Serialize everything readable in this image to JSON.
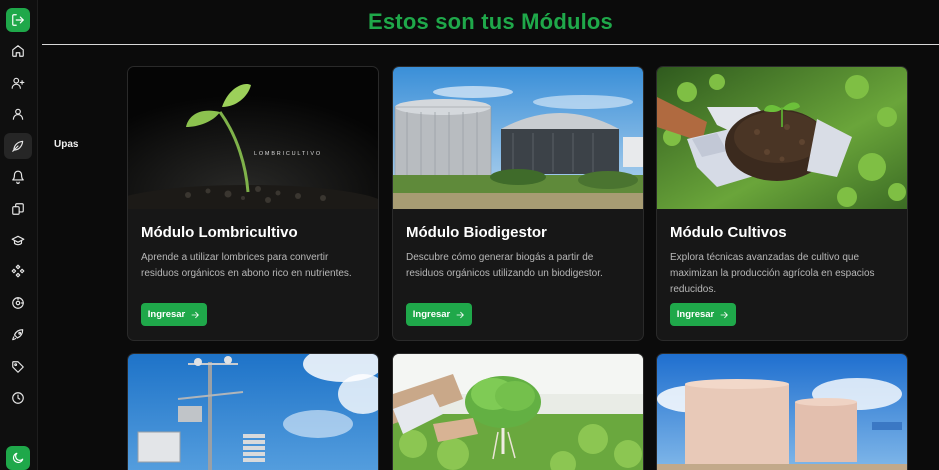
{
  "page": {
    "title": "Estos son tus Módulos"
  },
  "sidebar": {
    "icons": [
      "logout-icon",
      "home-icon",
      "user-plus-icon",
      "user-icon",
      "leaf-icon",
      "bell-icon",
      "cards-icon",
      "graduation-cap-icon",
      "modules-icon",
      "target-icon",
      "rocket-icon",
      "tag-icon",
      "clock-icon",
      "moon-icon"
    ],
    "active_tooltip": "Upas"
  },
  "modules": [
    {
      "title": "Módulo Lombricultivo",
      "description": "Aprende a utilizar lombrices para convertir residuos orgánicos en abono rico en nutrientes.",
      "button": "Ingresar",
      "image_text": "LOMBRICULTIVO"
    },
    {
      "title": "Módulo Biodigestor",
      "description": "Descubre cómo generar biogás a partir de residuos orgánicos utilizando un biodigestor.",
      "button": "Ingresar"
    },
    {
      "title": "Módulo Cultivos",
      "description": "Explora técnicas avanzadas de cultivo que maximizan la producción agrícola en espacios reducidos.",
      "button": "Ingresar"
    }
  ],
  "colors": {
    "accent": "#1fa84a",
    "background": "#0b0b0b",
    "card": "#171717"
  }
}
